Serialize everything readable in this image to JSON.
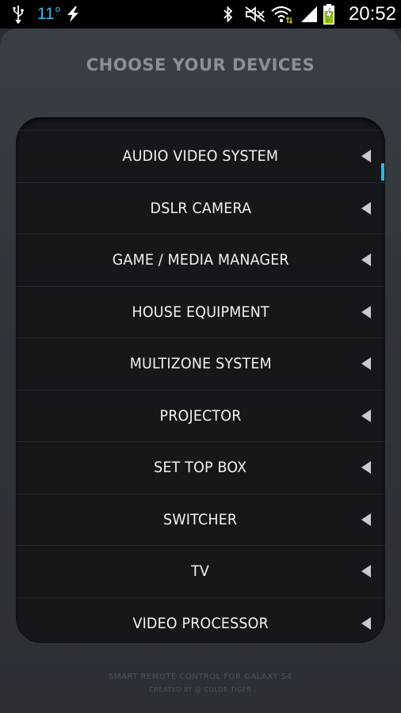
{
  "status_bar": {
    "temperature": "11°",
    "time": "20:52"
  },
  "header": {
    "title": "CHOOSE YOUR DEVICES"
  },
  "devices": [
    "AUDIO VIDEO SYSTEM",
    "DSLR CAMERA",
    "GAME / MEDIA MANAGER",
    "HOUSE EQUIPMENT",
    "MULTIZONE SYSTEM",
    "PROJECTOR",
    "SET TOP BOX",
    "SWITCHER",
    "TV",
    "VIDEO PROCESSOR"
  ],
  "footer": {
    "line1": "SMART REMOTE CONTROL FOR GALAXY S4",
    "line2": "CREATED BY @ COLOR TIGER"
  },
  "colors": {
    "accent": "#33b5e5",
    "background": "#2a2e33",
    "list_bg": "#15171a"
  }
}
